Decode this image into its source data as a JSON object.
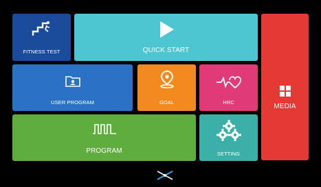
{
  "tiles": {
    "fitness_test": {
      "label": "FITNESS TEST",
      "color": "#1a4a9a",
      "icon": "stairs-runner-icon"
    },
    "quick_start": {
      "label": "QUICK START",
      "color": "#4ec6d2",
      "icon": "play-icon"
    },
    "media": {
      "label": "MEDIA",
      "color": "#e53935",
      "icon": "grid-icon"
    },
    "user_program": {
      "label": "USER PROGRAM",
      "color": "#2a72c6",
      "icon": "user-folder-icon"
    },
    "goal": {
      "label": "GOAL",
      "color": "#f28a20",
      "icon": "location-pin-icon"
    },
    "hrc": {
      "label": "HRC",
      "color": "#e03a77",
      "icon": "heart-rate-icon"
    },
    "program": {
      "label": "PROGRAM",
      "color": "#5fae3d",
      "icon": "pulse-wave-icon"
    },
    "setting": {
      "label": "SETTING",
      "color": "#3ab0a8",
      "icon": "gears-icon"
    }
  },
  "footer": {
    "icon": "brand-logo-icon"
  }
}
